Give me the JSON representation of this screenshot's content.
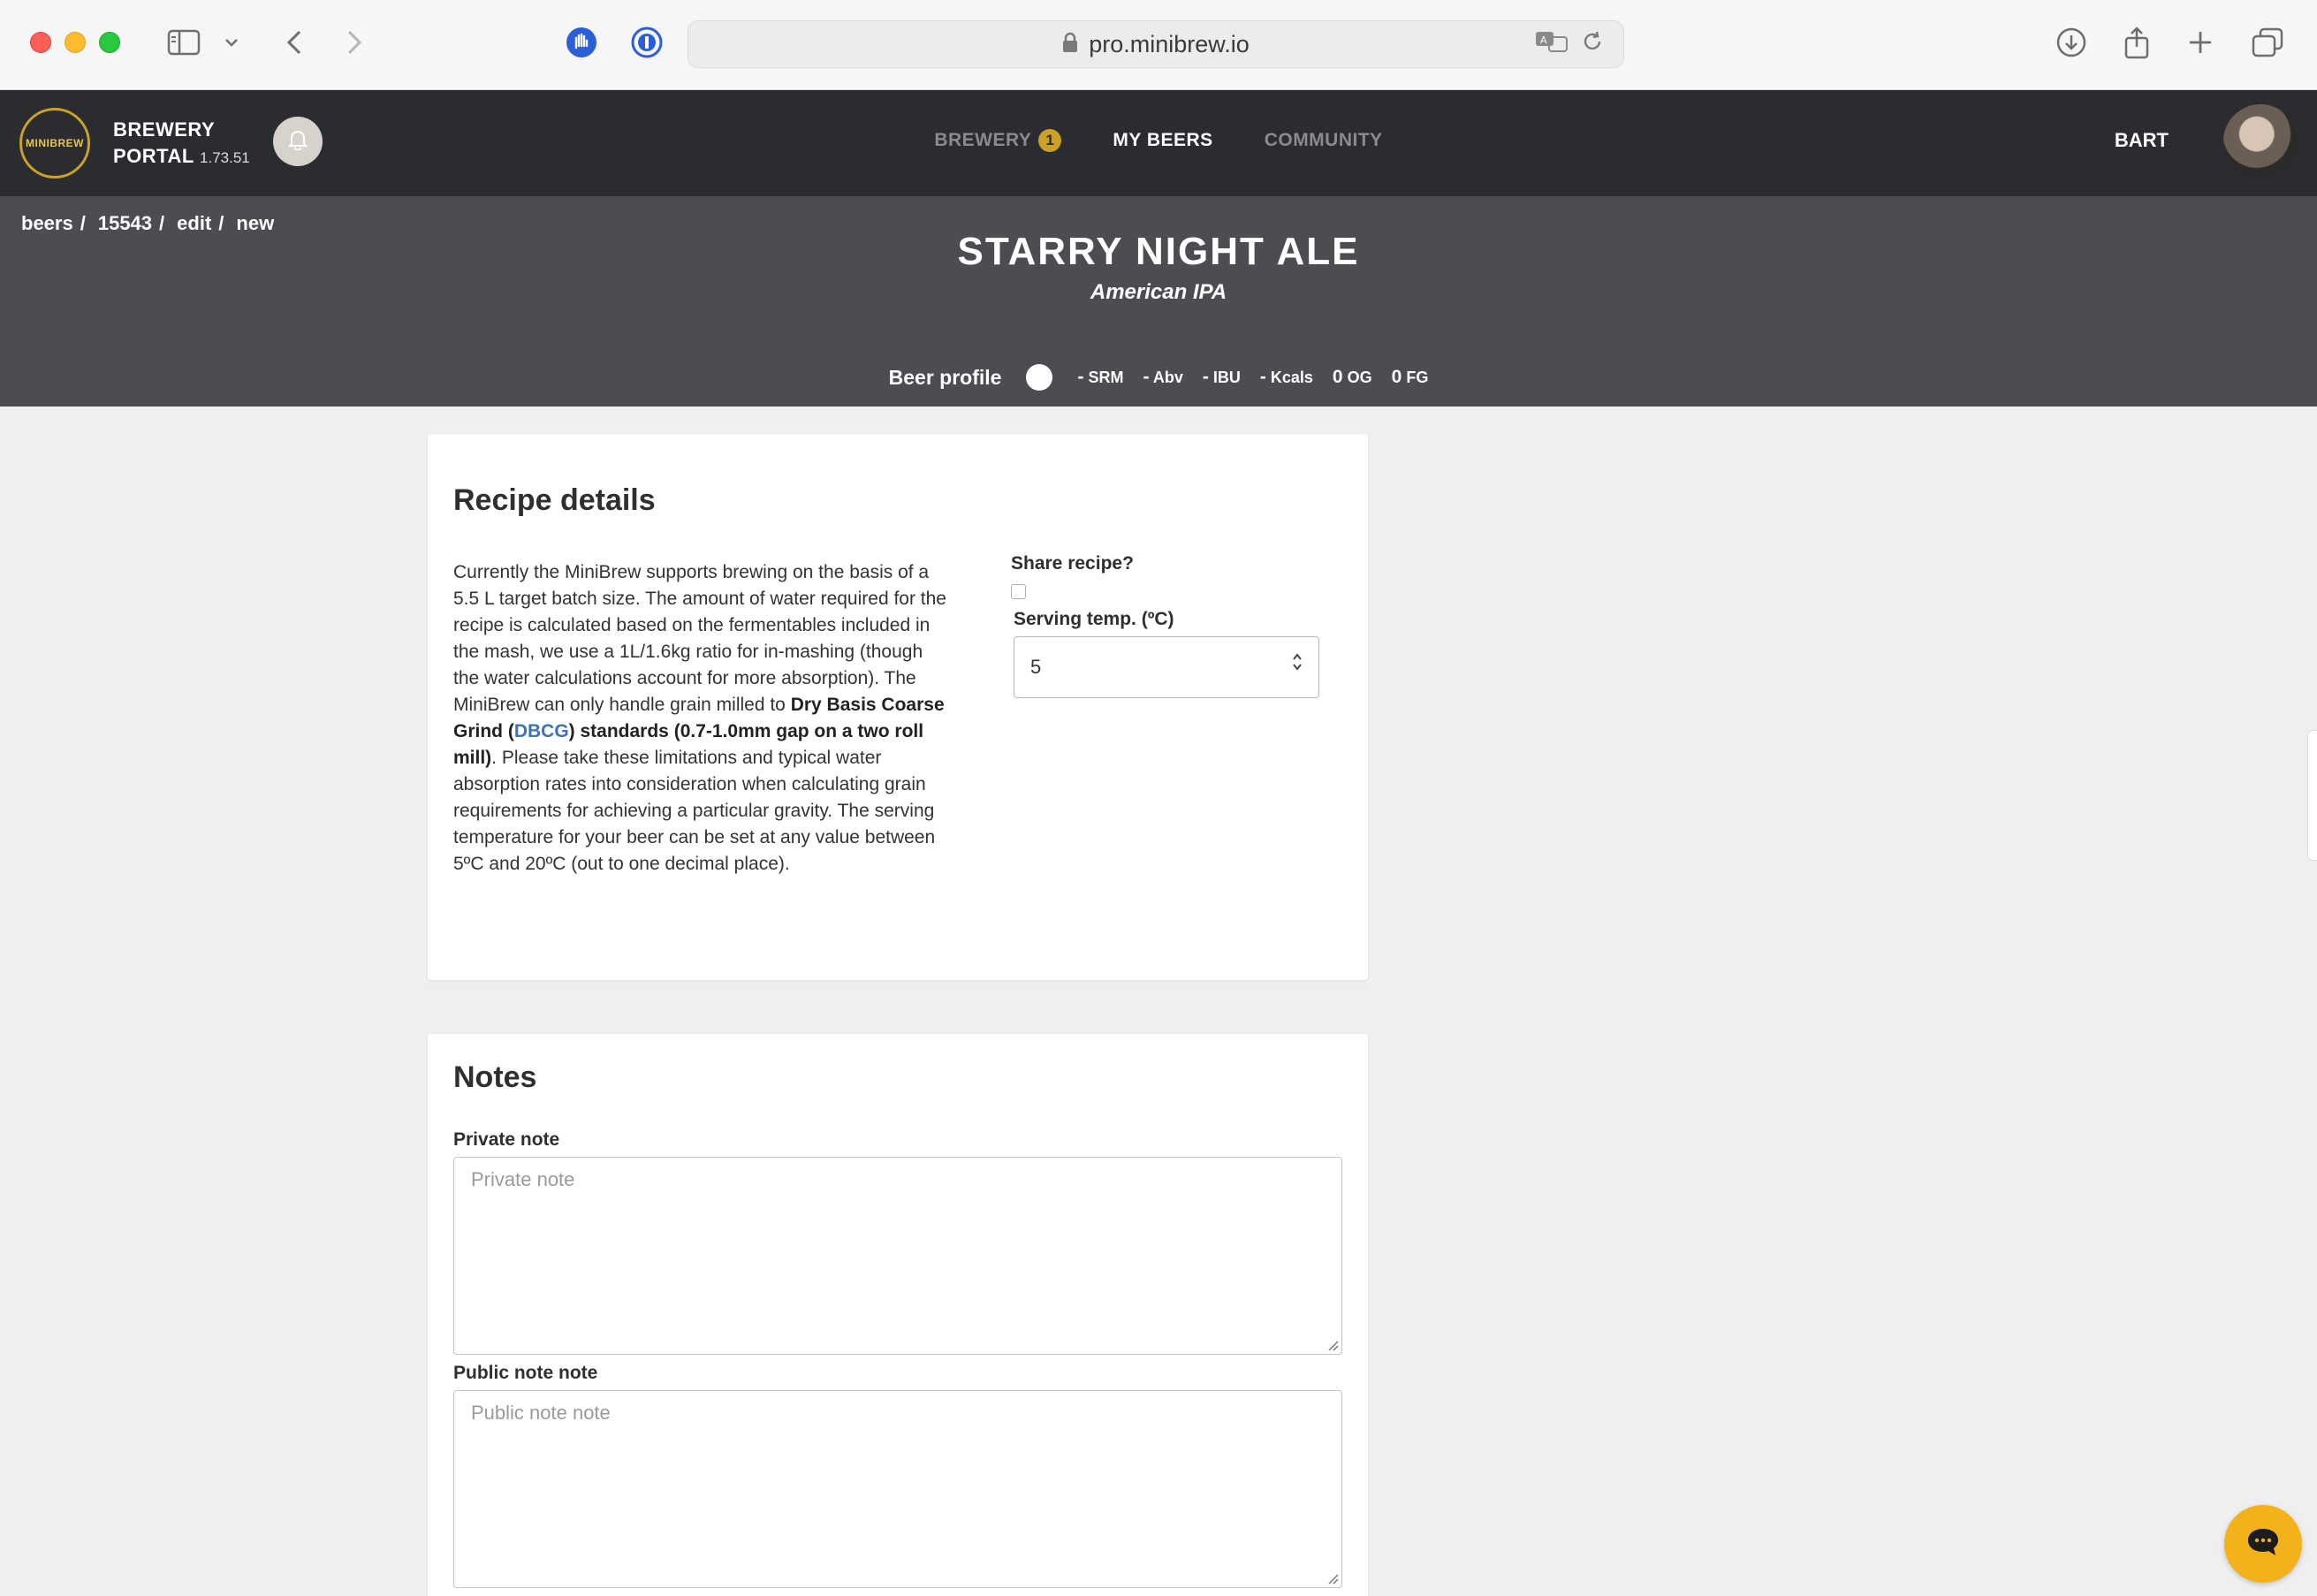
{
  "browser": {
    "url": "pro.minibrew.io"
  },
  "app": {
    "logo_text": "MINIBREW",
    "portal_line1": "BREWERY",
    "portal_line2": "PORTAL",
    "version": "1.73.51",
    "nav": [
      {
        "label": "BREWERY",
        "badge": "1"
      },
      {
        "label": "MY BEERS"
      },
      {
        "label": "COMMUNITY"
      }
    ],
    "user_name": "BART"
  },
  "hero": {
    "breadcrumb": [
      "beers",
      "15543",
      "edit",
      "new"
    ],
    "beer_name": "STARRY NIGHT ALE",
    "beer_style": "American IPA",
    "profile_label": "Beer profile",
    "stats": [
      {
        "value": "-",
        "unit": "SRM"
      },
      {
        "value": "-",
        "unit": "Abv"
      },
      {
        "value": "-",
        "unit": "IBU"
      },
      {
        "value": "-",
        "unit": "Kcals"
      },
      {
        "value": "0",
        "unit": "OG"
      },
      {
        "value": "0",
        "unit": "FG"
      }
    ]
  },
  "recipe": {
    "title": "Recipe details",
    "text_part1": "Currently the MiniBrew supports brewing on the basis of a 5.5 L target batch size. The amount of water required for the recipe is calculated based on the fermentables included in the mash, we use a 1L/1.6kg ratio for in-mashing (though the water calculations account for more absorption). The MiniBrew can only handle grain milled to ",
    "text_bold1": "Dry Basis Coarse Grind (",
    "text_link": "DBCG",
    "text_bold2": ") standards (0.7-1.0mm gap on a two roll mill)",
    "text_part2": ". Please take these limitations and typical water absorption rates into consideration when calculating grain requirements for achieving a particular gravity. The serving temperature for your beer can be set at any value between 5ºC and 20ºC (out to one decimal place).",
    "share_label": "Share recipe?",
    "serving_label": "Serving temp. (ºC)",
    "serving_value": "5"
  },
  "notes": {
    "title": "Notes",
    "private_label": "Private note",
    "private_placeholder": "Private note",
    "public_label": "Public note note",
    "public_placeholder": "Public note note"
  }
}
